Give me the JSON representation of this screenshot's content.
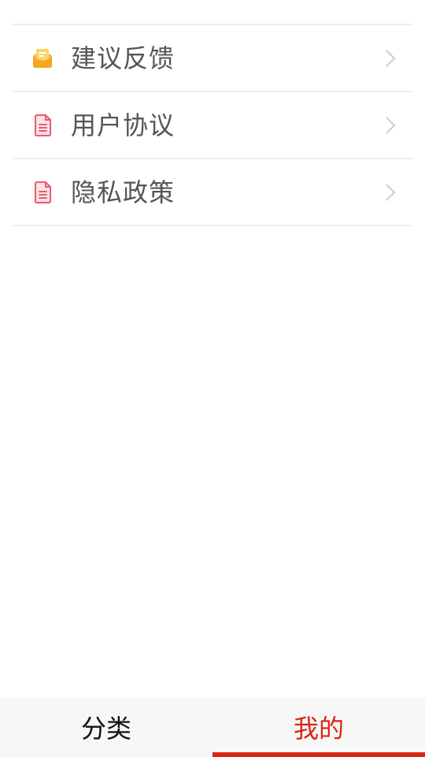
{
  "menu": {
    "items": [
      {
        "icon": "mail-icon",
        "label": "建议反馈",
        "icon_color": "#f7b43c"
      },
      {
        "icon": "document-icon",
        "label": "用户协议",
        "icon_color": "#ea5a6f"
      },
      {
        "icon": "document-icon",
        "label": "隐私政策",
        "icon_color": "#ea5a6f"
      }
    ]
  },
  "tabbar": {
    "tabs": [
      {
        "label": "分类",
        "active": false
      },
      {
        "label": "我的",
        "active": true
      }
    ],
    "accent_color": "#d82613"
  }
}
